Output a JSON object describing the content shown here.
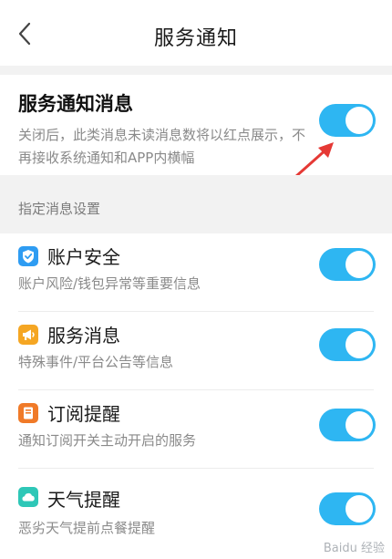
{
  "header": {
    "title": "服务通知"
  },
  "main_setting": {
    "title": "服务通知消息",
    "description": "关闭后，此类消息未读消息数将以红点展示，不再接收系统通知和APP内横幅",
    "enabled": true
  },
  "section": {
    "label": "指定消息设置"
  },
  "items": [
    {
      "title": "账户安全",
      "description": "账户风险/钱包异常等重要信息",
      "icon": "shield-icon",
      "color": "#2e9cf2",
      "enabled": true
    },
    {
      "title": "服务消息",
      "description": "特殊事件/平台公告等信息",
      "icon": "megaphone-icon",
      "color": "#f5a623",
      "enabled": true
    },
    {
      "title": "订阅提醒",
      "description": "通知订阅开关主动开启的服务",
      "icon": "bookmark-icon",
      "color": "#f07a28",
      "enabled": true
    },
    {
      "title": "天气提醒",
      "description": "恶劣天气提前点餐提醒",
      "icon": "cloud-icon",
      "color": "#2ec7b7",
      "enabled": true
    }
  ],
  "theme": {
    "toggle_on": "#2eb6f2",
    "annotation_arrow": "#e53935"
  },
  "watermark": {
    "text": "Baidu 经验"
  }
}
